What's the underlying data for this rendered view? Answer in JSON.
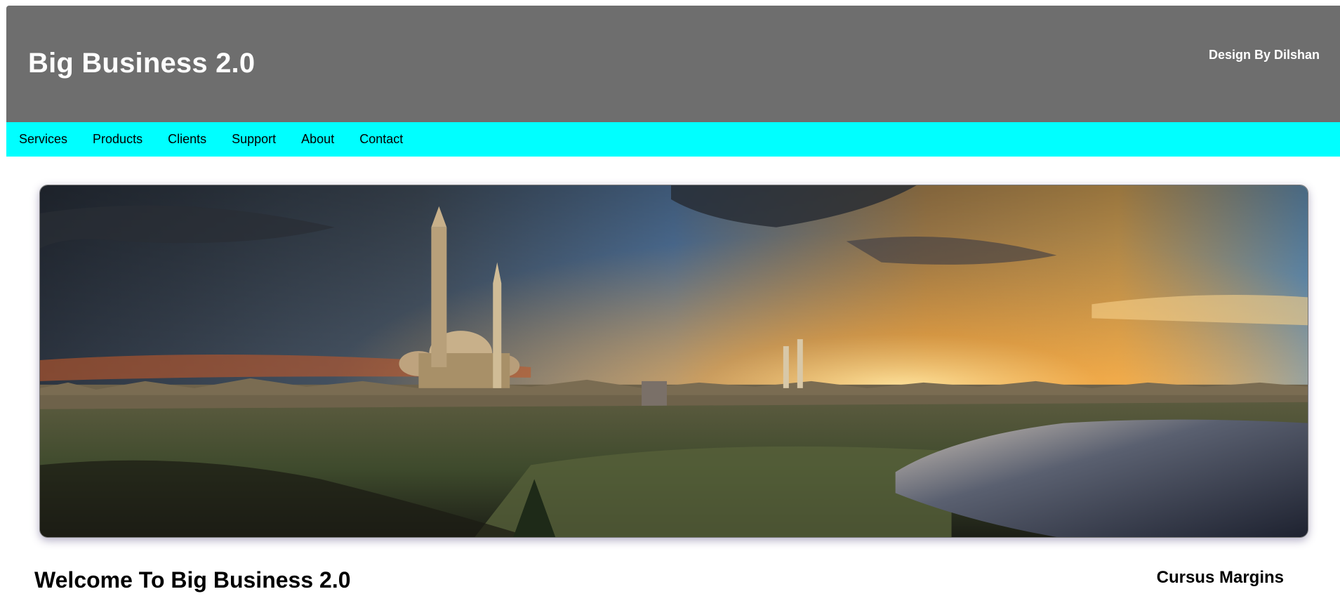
{
  "header": {
    "title": "Big Business 2.0",
    "credit": "Design By Dilshan",
    "background": "#6e6e6e"
  },
  "nav": {
    "background": "#00ffff",
    "items": [
      {
        "label": "Services"
      },
      {
        "label": "Products"
      },
      {
        "label": "Clients"
      },
      {
        "label": "Support"
      },
      {
        "label": "About"
      },
      {
        "label": "Contact"
      }
    ]
  },
  "banner": {
    "image": "city-skyline-sunset-image"
  },
  "main": {
    "heading": "Welcome To Big Business 2.0"
  },
  "sidebar": {
    "heading": "Cursus Margins"
  }
}
